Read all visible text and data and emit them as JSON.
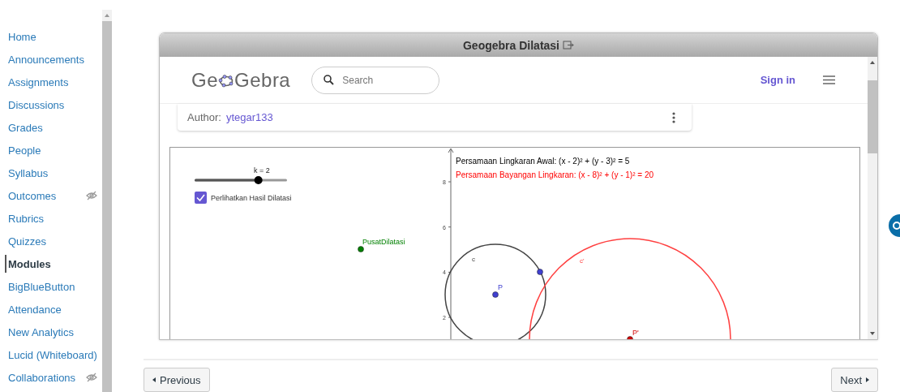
{
  "sidebar": {
    "items": [
      {
        "label": "Home",
        "selected": false,
        "hidden": false
      },
      {
        "label": "Announcements",
        "selected": false,
        "hidden": false
      },
      {
        "label": "Assignments",
        "selected": false,
        "hidden": false
      },
      {
        "label": "Discussions",
        "selected": false,
        "hidden": false
      },
      {
        "label": "Grades",
        "selected": false,
        "hidden": false
      },
      {
        "label": "People",
        "selected": false,
        "hidden": false
      },
      {
        "label": "Syllabus",
        "selected": false,
        "hidden": false
      },
      {
        "label": "Outcomes",
        "selected": false,
        "hidden": true
      },
      {
        "label": "Rubrics",
        "selected": false,
        "hidden": false
      },
      {
        "label": "Quizzes",
        "selected": false,
        "hidden": false
      },
      {
        "label": "Modules",
        "selected": true,
        "hidden": false
      },
      {
        "label": "BigBlueButton",
        "selected": false,
        "hidden": false
      },
      {
        "label": "Attendance",
        "selected": false,
        "hidden": false
      },
      {
        "label": "New Analytics",
        "selected": false,
        "hidden": false
      },
      {
        "label": "Lucid (Whiteboard)",
        "selected": false,
        "hidden": false
      },
      {
        "label": "Collaborations",
        "selected": false,
        "hidden": true
      }
    ]
  },
  "frame": {
    "title": "Geogebra Dilatasi"
  },
  "geogebra": {
    "logo": {
      "before": "Ge",
      "after": "Gebra"
    },
    "search": {
      "placeholder": "Search"
    },
    "sign_in": "Sign in",
    "author": {
      "label": "Author:",
      "name": "ytegar133"
    },
    "applet": {
      "slider": {
        "label": "k = 2",
        "level": 0.69
      },
      "checkbox": {
        "label": "Perlihatkan Hasil Dilatasi",
        "checked": true
      },
      "y_ticks": [
        "8",
        "6",
        "4",
        "2"
      ],
      "equations": [
        {
          "text": "Persamaan Lingkaran Awal: (x - 2)² + (y - 3)² = 5",
          "color": "#000000"
        },
        {
          "text": "Persamaan Bayangan Lingkaran: (x - 8)² + (y - 1)² = 20",
          "color": "#ff0000"
        }
      ],
      "circles": [
        {
          "label": "c",
          "color": "#444444"
        },
        {
          "label": "c'",
          "color": "#ff4040"
        }
      ],
      "points": [
        {
          "label": "PusatDilatasi",
          "color": "#008000"
        },
        {
          "label": "P",
          "color": "#4040d0"
        },
        {
          "label": "P'",
          "color": "#d00000"
        }
      ]
    }
  },
  "footer": {
    "previous": "Previous",
    "next": "Next"
  }
}
